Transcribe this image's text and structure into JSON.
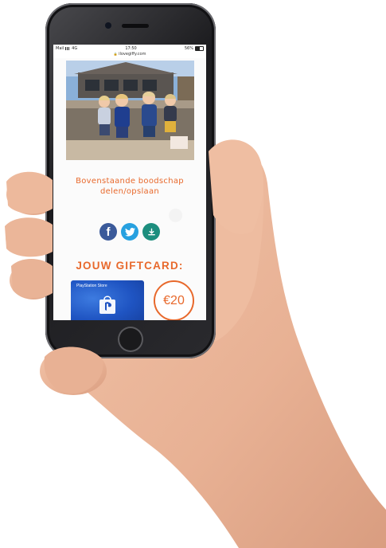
{
  "status_bar": {
    "carrier": "Mail",
    "network": "4G",
    "time": "17:50",
    "battery": "56%"
  },
  "url_bar": {
    "url": "ilovegiffy.com"
  },
  "message": {
    "line1": "Bovenstaande boodschap",
    "line2": "delen/opslaan"
  },
  "share_buttons": [
    {
      "name": "facebook",
      "icon": "facebook-icon",
      "color": "#3b5a9a"
    },
    {
      "name": "twitter",
      "icon": "twitter-icon",
      "color": "#27a1e0"
    },
    {
      "name": "download",
      "icon": "download-icon",
      "color": "#1d8e7e"
    }
  ],
  "giftcard": {
    "heading": "JOUW GIFTCARD:",
    "card_label": "PlayStation Store",
    "amount": "€20"
  },
  "colors": {
    "accent": "#e8692c"
  }
}
